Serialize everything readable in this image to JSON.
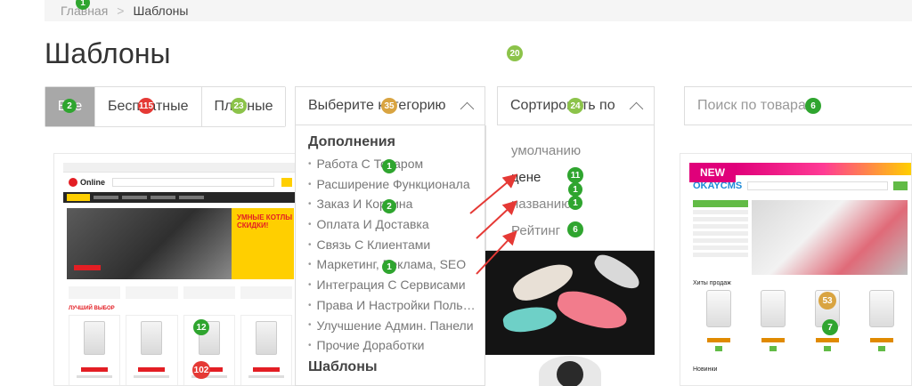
{
  "breadcrumb": {
    "home": "Главная",
    "separator": ">",
    "current": "Шаблоны"
  },
  "page_title": "Шаблоны",
  "filters": {
    "all": "Все",
    "free": "Бесплатные",
    "paid": "Платные"
  },
  "category_select": {
    "label": "Выберите категорию",
    "groups": [
      {
        "heading": "Дополнения",
        "items": [
          "Работа С Товаром",
          "Расширение Функционала",
          "Заказ И Корзина",
          "Оплата И Доставка",
          "Связь С Клиентами",
          "Маркетинг, Реклама, SEO",
          "Интеграция С Сервисами",
          "Права И Настройки Пользователей",
          "Улучшение Админ. Панели",
          "Прочие Доработки"
        ]
      },
      {
        "heading": "Шаблоны",
        "items": []
      }
    ]
  },
  "sort_select": {
    "label": "Сортировать по",
    "options": [
      "умолчанию",
      "цене",
      "названию",
      "Рейтинг"
    ],
    "selected_index": 1
  },
  "search": {
    "placeholder": "Поиск по товарам"
  },
  "products": [
    {
      "logo": "Online",
      "promo": "УМНЫЕ КОТЛЫ СКИДКИ!",
      "section": "ЛУЧШИЙ ВЫБОР"
    },
    {},
    {
      "new_badge": "NEW",
      "logo": "OKAYCMS",
      "section": "Хиты продаж",
      "bottom_section": "Новинки"
    }
  ],
  "badges": [
    {
      "text": "1",
      "color": "g"
    },
    {
      "text": "2",
      "color": "g"
    },
    {
      "text": "115",
      "color": "r"
    },
    {
      "text": "23",
      "color": "lg"
    },
    {
      "text": "35",
      "color": "o"
    },
    {
      "text": "24",
      "color": "lg"
    },
    {
      "text": "6",
      "color": "g"
    },
    {
      "text": "20",
      "color": "lg"
    },
    {
      "text": "1",
      "color": "g"
    },
    {
      "text": "2",
      "color": "g"
    },
    {
      "text": "1",
      "color": "g"
    },
    {
      "text": "11",
      "color": "g"
    },
    {
      "text": "1",
      "color": "g"
    },
    {
      "text": "1",
      "color": "g"
    },
    {
      "text": "6",
      "color": "g"
    },
    {
      "text": "12",
      "color": "g"
    },
    {
      "text": "102",
      "color": "r"
    },
    {
      "text": "53",
      "color": "o"
    },
    {
      "text": "7",
      "color": "g"
    }
  ]
}
